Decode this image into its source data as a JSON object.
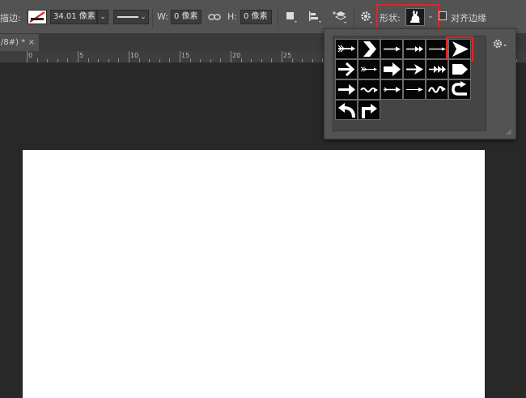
{
  "options_bar": {
    "stroke_label": "描边:",
    "stroke_width": "34.01 像素",
    "width_label": "W:",
    "width_value": "0 像素",
    "link_icon": "link-icon",
    "height_label": "H:",
    "height_value": "0 像素",
    "shape_label": "形状:",
    "align_edges_label": "对齐边缘",
    "align_edges_checked": false,
    "accent": "#e02424"
  },
  "tabs": [
    {
      "title": "/8#) *",
      "close": "×"
    }
  ],
  "ruler": {
    "labels": [
      "0",
      "5",
      "10",
      "15",
      "20",
      "25"
    ]
  },
  "shape_picker": {
    "settings_icon": "gear-icon",
    "selected_index": 5,
    "shapes": [
      "arrow-feathered-icon",
      "chevron-arrow-icon",
      "arrow-thin-long-icon",
      "arrow-double-tip-icon",
      "arrow-thin-icon",
      "triangle-arrow-icon",
      "arrow-right-selected-icon",
      "arrow-tail-icon",
      "arrow-bold-icon",
      "arrow-notched-icon",
      "arrow-triple-head-icon",
      "arrow-pentagon-icon",
      "arrow-plain-icon",
      "arrow-wavy-icon",
      "arrow-fletched-icon",
      "arrow-slim-icon",
      "arrow-squiggle-icon",
      "arrow-uturn-icon",
      "arrow-curved-left-icon",
      "arrow-turn-right-icon"
    ]
  }
}
